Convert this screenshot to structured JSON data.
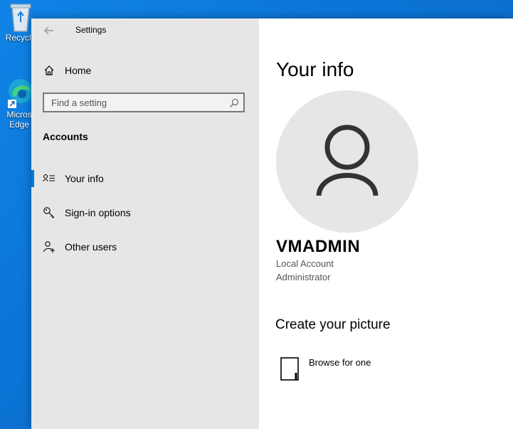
{
  "desktop": {
    "icons": [
      {
        "label": "Recycle",
        "icon": "recycle-bin-icon"
      },
      {
        "label": "Micros Edge",
        "line1": "Micros",
        "line2": "Edge",
        "icon": "edge-browser-icon"
      }
    ]
  },
  "window": {
    "title": "Settings",
    "back_icon": "back-arrow-icon"
  },
  "nav": {
    "home_label": "Home",
    "search_placeholder": "Find a setting",
    "search_value": "",
    "section_heading": "Accounts",
    "items": [
      {
        "label": "Your info",
        "icon": "person-card-icon",
        "selected": true
      },
      {
        "label": "Sign-in options",
        "icon": "key-icon",
        "selected": false
      },
      {
        "label": "Other users",
        "icon": "person-add-icon",
        "selected": false
      }
    ]
  },
  "content": {
    "title": "Your info",
    "user_name": "VMADMIN",
    "account_type": "Local Account",
    "account_role": "Administrator",
    "create_heading": "Create your picture",
    "browse_label": "Browse for one"
  },
  "colors": {
    "accent": "#0078d7",
    "nav_background": "#e6e6e6",
    "desktop_background": "#0a79d6"
  }
}
